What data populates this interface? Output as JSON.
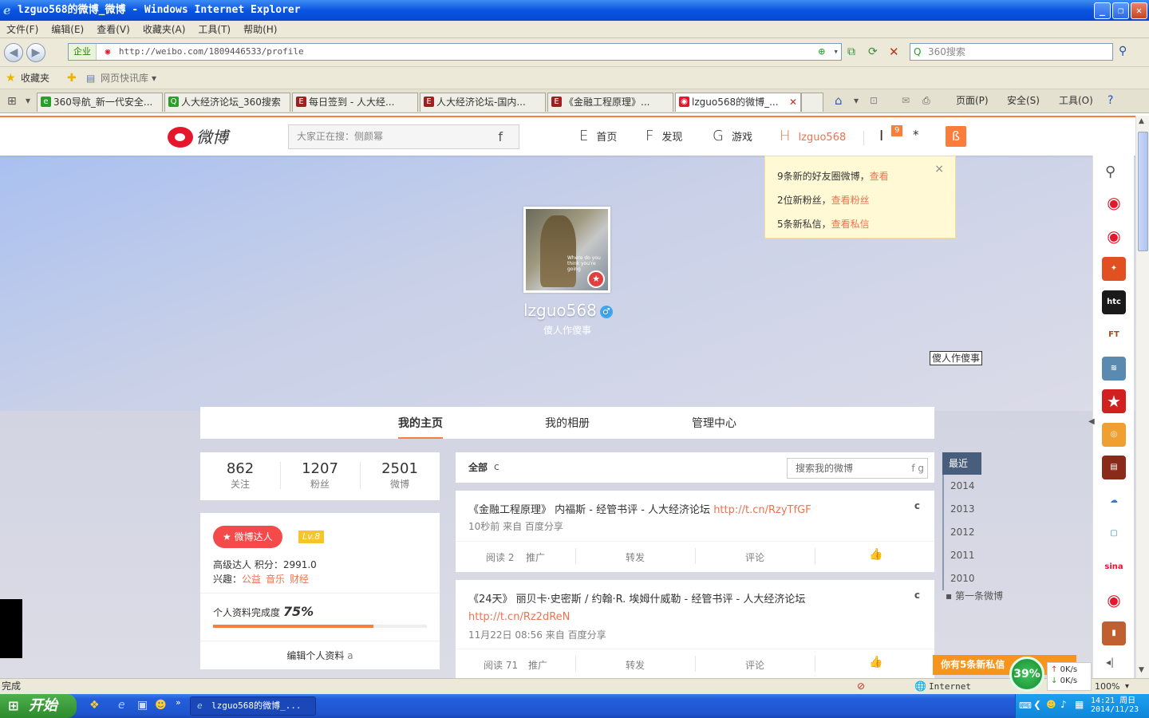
{
  "window": {
    "title": "lzguo568的微博_微博 - Windows Internet Explorer"
  },
  "menu": [
    "文件(F)",
    "编辑(E)",
    "查看(V)",
    "收藏夹(A)",
    "工具(T)",
    "帮助(H)"
  ],
  "address": {
    "zone": "企业",
    "url": "http://weibo.com/1809446533/profile",
    "search_placeholder": "360搜索"
  },
  "favorites": {
    "label": "收藏夹",
    "quicklib": "网页快讯库"
  },
  "tabs": [
    {
      "label": "360导航_新一代安全...",
      "color": "#2a9d2a"
    },
    {
      "label": "人大经济论坛_360搜索",
      "color": "#2a9d2a"
    },
    {
      "label": "每日签到 - 人大经...",
      "color": "#a02020"
    },
    {
      "label": "人大经济论坛-国内...",
      "color": "#a02020"
    },
    {
      "label": "《金融工程原理》...",
      "color": "#a02020"
    },
    {
      "label": "lzguo568的微博_...",
      "color": "#e6162d"
    }
  ],
  "cmdbar": {
    "page": "页面(P)",
    "safety": "安全(S)",
    "tools": "工具(O)"
  },
  "weibo": {
    "logo": "微博",
    "search_placeholder": "大家正在搜：侧颜幂",
    "search_glyph": "f",
    "nav": [
      {
        "glyph": "E",
        "label": "首页"
      },
      {
        "glyph": "F",
        "label": "发现"
      },
      {
        "glyph": "G",
        "label": "游戏"
      },
      {
        "glyph": "H",
        "label": "lzguo568"
      }
    ],
    "nav_badge": "9",
    "nav_extra_glyph": "I",
    "nav_star": "*",
    "nav_post_glyph": "ß"
  },
  "notice": {
    "line1": "9条新的好友圈微博，",
    "link1": "查看",
    "line2": "2位新粉丝，",
    "link2": "查看粉丝",
    "line3": "5条新私信，",
    "link3": "查看私信",
    "close": "×"
  },
  "profile": {
    "name": "lzguo568",
    "desc": "傻人作傻事",
    "tooltip": "傻人作傻事",
    "avatar_text": "Where do you think you're going"
  },
  "subnav": [
    "我的主页",
    "我的相册",
    "管理中心"
  ],
  "stats": [
    {
      "num": "862",
      "label": "关注"
    },
    {
      "num": "1207",
      "label": "粉丝"
    },
    {
      "num": "2501",
      "label": "微博"
    }
  ],
  "badge": {
    "daren": "微博达人",
    "level": "Lv.8"
  },
  "info": {
    "line1": "高级达人  积分：2991.0",
    "interest_label": "兴趣：",
    "interests": [
      "公益",
      "音乐",
      "财经"
    ],
    "completion_label": "个人资料完成度",
    "completion": "75%",
    "completion_value": 0.75,
    "edit": "编辑个人资料",
    "edit_glyph": "a"
  },
  "feed": {
    "tab": "全部",
    "tab_glyph": "c",
    "search_placeholder": "搜索我的微博",
    "search_glyph": "f g",
    "posts": [
      {
        "text": "《金融工程原理》 内福斯 - 经管书评 - 人大经济论坛 ",
        "link": "http://t.cn/RzyTfGF",
        "meta": "10秒前 来自 百度分享",
        "read": "阅读 2",
        "promote": "推广",
        "forward": "转发",
        "comment": "评论"
      },
      {
        "text": "《24天》 丽贝卡·史密斯 / 约翰·R. 埃姆什威勒 - 经管书评 - 人大经济论坛",
        "link": "http://t.cn/Rz2dReN",
        "meta": "11月22日 08:56 来自 百度分享",
        "read": "阅读 71",
        "promote": "推广",
        "forward": "转发",
        "comment": "评论"
      }
    ]
  },
  "timeline": {
    "current": "最近",
    "years": [
      "2014",
      "2013",
      "2012",
      "2011",
      "2010"
    ],
    "first": "第一条微博"
  },
  "msgbar": "你有5条新私信",
  "side_icons": [
    "weibo",
    "weibo",
    "rooster",
    "htc",
    "FT",
    "landscape",
    "star",
    "eye",
    "news",
    "cloud",
    "box",
    "sina",
    "weibo",
    "book"
  ],
  "status": {
    "left": "完成",
    "zone": "Internet",
    "zoom": "100%"
  },
  "gauge": "39%",
  "net": {
    "up": "0K/s",
    "down": "0K/s"
  },
  "taskbar": {
    "start": "开始",
    "item": "lzguo568的微博_...",
    "time": "14:21 周日",
    "date": "2014/11/23"
  }
}
